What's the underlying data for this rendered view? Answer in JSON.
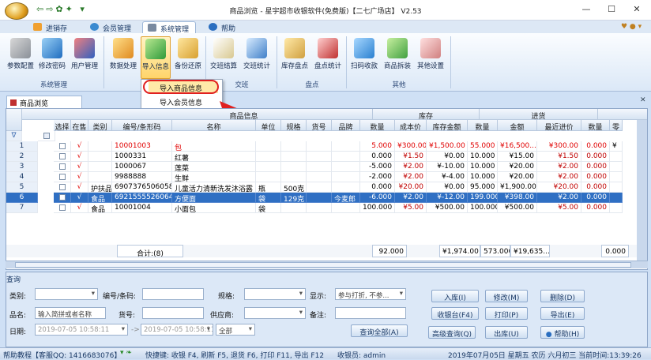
{
  "window": {
    "title": "商品浏览 - 星宇超市收银软件(免费版)【二七广场店】 V2.53",
    "min": "—",
    "max": "☐",
    "close": "✕"
  },
  "tabs": [
    {
      "label": "进销存"
    },
    {
      "label": "会员管理"
    },
    {
      "label": "系统管理"
    },
    {
      "label": "帮助"
    }
  ],
  "ribbon": {
    "buttons": [
      "参数配置",
      "修改密码",
      "用户管理",
      "数据处理",
      "导入信息",
      "备份还原",
      "交班结算",
      "交班统计",
      "库存盘点",
      "盘点统计",
      "扫码收款",
      "商品拆装",
      "其他设置"
    ],
    "groups": [
      "系统管理",
      "交班",
      "盘点",
      "其他"
    ],
    "menu": [
      "导入商品信息",
      "导入会员信息"
    ]
  },
  "doc_tab": "商品浏览",
  "grid": {
    "groups": {
      "info": "商品信息",
      "stock": "库存",
      "purchase": "进货"
    },
    "columns": [
      "选择",
      "在售",
      "类别",
      "编号/条形码",
      "名称",
      "单位",
      "规格",
      "货号",
      "品牌",
      "数量",
      "成本价",
      "库存金额",
      "数量",
      "金额",
      "最近进价",
      "数量",
      "零"
    ],
    "rows": [
      {
        "n": "1",
        "on": "√",
        "cat": "",
        "code": "10001003",
        "name": "包",
        "unit": "",
        "spec": "",
        "no": "",
        "brand": "",
        "qty": "5.000",
        "cost": "¥300.00",
        "amt": "¥1,500.00",
        "pq": "55.000",
        "pamt": "¥16,500....",
        "last": "¥300.00",
        "q2": "0.000",
        "z": "¥",
        "red": true
      },
      {
        "n": "2",
        "on": "√",
        "cat": "",
        "code": "1000331",
        "name": "红薯",
        "unit": "",
        "spec": "",
        "no": "",
        "brand": "",
        "qty": "0.000",
        "cost": "¥1.50",
        "amt": "¥0.00",
        "pq": "10.000",
        "pamt": "¥15.00",
        "last": "¥1.50",
        "q2": "0.000",
        "z": "",
        "red": false
      },
      {
        "n": "3",
        "on": "√",
        "cat": "",
        "code": "1000067",
        "name": "莲菜",
        "unit": "",
        "spec": "",
        "no": "",
        "brand": "",
        "qty": "-5.000",
        "cost": "¥2.00",
        "amt": "¥-10.00",
        "pq": "10.000",
        "pamt": "¥20.00",
        "last": "¥2.00",
        "q2": "0.000",
        "z": "",
        "red": false
      },
      {
        "n": "4",
        "on": "√",
        "cat": "",
        "code": "9988888",
        "name": "生鲜",
        "unit": "",
        "spec": "",
        "no": "",
        "brand": "",
        "qty": "-2.000",
        "cost": "¥2.00",
        "amt": "¥-4.00",
        "pq": "10.000",
        "pamt": "¥20.00",
        "last": "¥2.00",
        "q2": "0.000",
        "z": "",
        "red": false
      },
      {
        "n": "5",
        "on": "√",
        "cat": "护扶品",
        "code": "6907376506058",
        "name": "儿童活力清新洗发沐浴露",
        "unit": "瓶",
        "spec": "500克",
        "no": "",
        "brand": "",
        "qty": "0.000",
        "cost": "¥20.00",
        "amt": "¥0.00",
        "pq": "95.000",
        "pamt": "¥1,900.00",
        "last": "¥20.00",
        "q2": "0.000",
        "z": "",
        "red": false
      },
      {
        "n": "6",
        "on": "√",
        "cat": "食品",
        "code": "6921555526064",
        "name": "方便面",
        "unit": "袋",
        "spec": "129克",
        "no": "",
        "brand": "今麦郎",
        "qty": "-6.000",
        "cost": "¥2.00",
        "amt": "¥-12.00",
        "pq": "199.000",
        "pamt": "¥398.00",
        "last": "¥2.00",
        "q2": "0.000",
        "z": "",
        "red": false,
        "selected": true
      },
      {
        "n": "7",
        "on": "√",
        "cat": "食品",
        "code": "10001004",
        "name": "小面包",
        "unit": "袋",
        "spec": "",
        "no": "",
        "brand": "",
        "qty": "100.000",
        "cost": "¥5.00",
        "amt": "¥500.00",
        "pq": "100.000",
        "pamt": "¥500.00",
        "last": "¥5.00",
        "q2": "0.000",
        "z": "",
        "red": false
      }
    ],
    "footer": {
      "label": "合计:(8)",
      "qty": "92.000",
      "amt": "¥1,974.00",
      "pq": "573.000",
      "pamt": "¥19,635....",
      "q2": "0.000"
    }
  },
  "query": {
    "title": "查询",
    "labels": {
      "cat": "类别:",
      "code": "编号/条码:",
      "spec": "规格:",
      "show": "显示:",
      "name": "品名:",
      "no": "货号:",
      "supplier": "供应商:",
      "note": "备注:",
      "date": "日期:"
    },
    "name_value": "输入简拼或者名称",
    "show_value": "参与打折, 不参...",
    "date_from": "2019-07-05 10:58:11",
    "date_to": "2019-07-05 10:58:11",
    "date_range": "全部",
    "date_sep": "->",
    "buttons": {
      "in": "入库(I)",
      "edit": "修改(M)",
      "del": "删除(D)",
      "cashier": "收银台(F4)",
      "print": "打印(P)",
      "export": "导出(E)",
      "queryall": "查询全部(A)",
      "advanced": "高级查询(Q)",
      "out": "出库(U)",
      "help": "帮助(H)"
    }
  },
  "status": {
    "left": "帮助教程【客服QQ: 1416683076】",
    "shortcuts": "快捷键: 收银 F4, 刷新 F5, 退货 F6, 打印 F11, 导出 F12",
    "cashier": "收银员: admin",
    "datetime": "2019年07月05日 星期五 农历 六月初三 当前时间:13:39:26"
  },
  "colors": {
    "accent": "#2f6fc3",
    "highlight": "#ffd46a",
    "red": "#e00000"
  }
}
